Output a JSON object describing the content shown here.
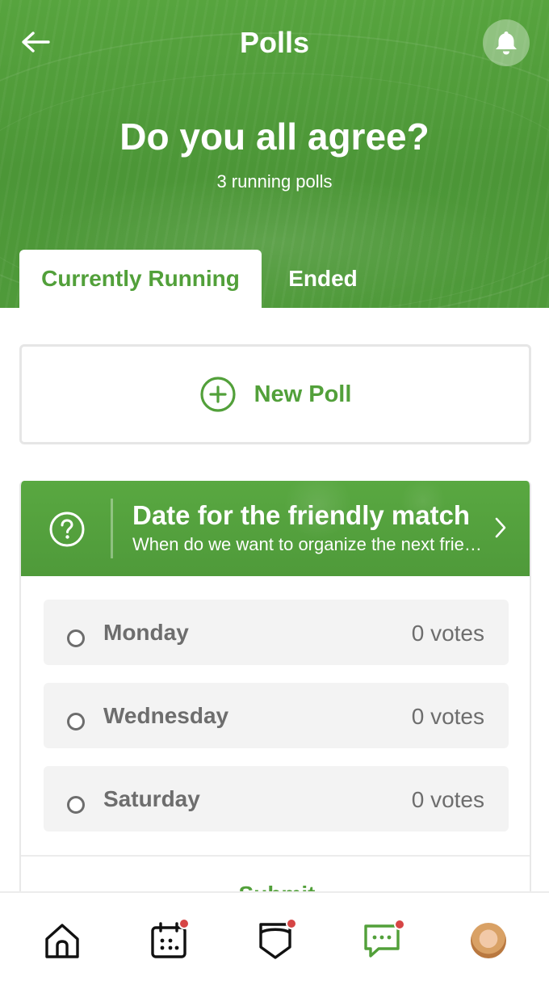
{
  "header": {
    "title": "Polls",
    "hero_title": "Do you all agree?",
    "hero_subtitle": "3 running polls"
  },
  "tabs": [
    {
      "label": "Currently Running",
      "active": true
    },
    {
      "label": "Ended",
      "active": false
    }
  ],
  "new_poll": {
    "label": "New Poll"
  },
  "poll": {
    "title": "Date for the friendly match",
    "description": "When do we want to organize the next friendly match?",
    "options": [
      {
        "label": "Monday",
        "votes": "0 votes"
      },
      {
        "label": "Wednesday",
        "votes": "0 votes"
      },
      {
        "label": "Saturday",
        "votes": "0 votes"
      }
    ],
    "submit_label": "Submit"
  },
  "bottom_nav": [
    {
      "icon": "home-icon",
      "badge": false,
      "active": false
    },
    {
      "icon": "calendar-icon",
      "badge": true,
      "active": false
    },
    {
      "icon": "team-shield-icon",
      "badge": true,
      "active": false
    },
    {
      "icon": "chat-icon",
      "badge": true,
      "active": true
    },
    {
      "icon": "profile-avatar",
      "badge": false,
      "active": false
    }
  ],
  "colors": {
    "brand_green": "#52a03a",
    "badge_red": "#d64545",
    "option_text": "#6d6d6d",
    "option_bg": "#f3f3f3"
  }
}
